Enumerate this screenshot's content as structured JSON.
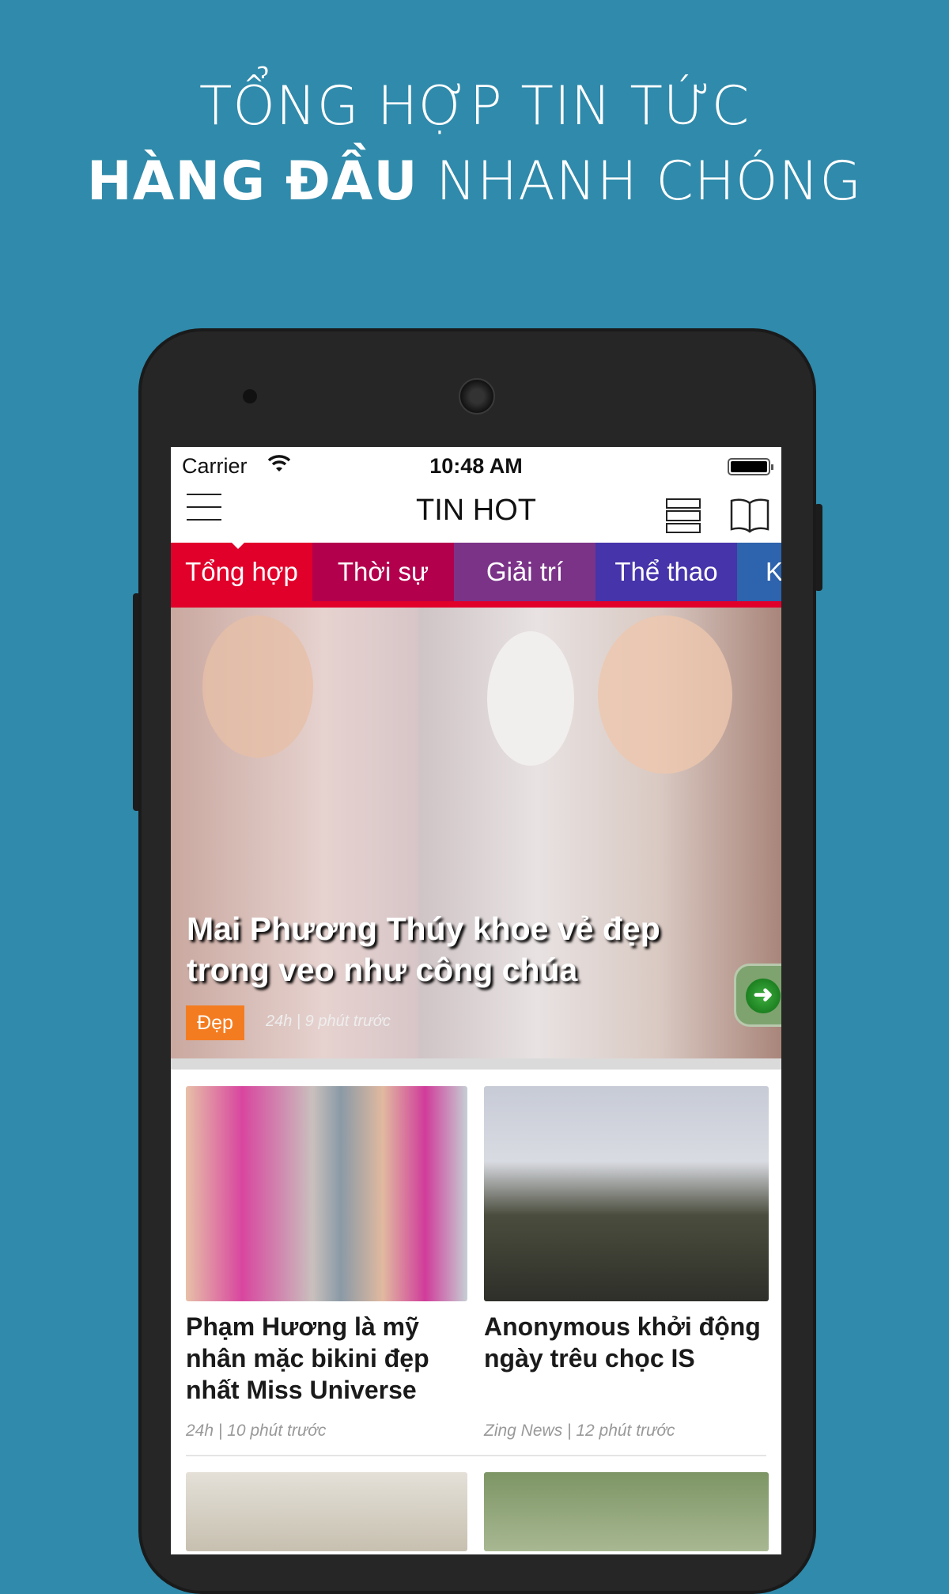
{
  "promo": {
    "line1": "TỔNG HỢP TIN TỨC",
    "line2_bold": "HÀNG ĐẦU",
    "line2_rest": " NHANH CHÓNG"
  },
  "status_bar": {
    "carrier": "Carrier",
    "time": "10:48 AM"
  },
  "nav": {
    "title": "TIN HOT",
    "icons": [
      "menu-icon",
      "list-view-icon",
      "book-icon"
    ]
  },
  "tabs": [
    {
      "label": "Tổng hợp",
      "color": "#e0002a",
      "active": true
    },
    {
      "label": "Thời sự",
      "color": "#b3004d"
    },
    {
      "label": "Giải trí",
      "color": "#7b3388"
    },
    {
      "label": "Thể thao",
      "color": "#4534aa"
    },
    {
      "label": "K",
      "color": "#2e63ad"
    }
  ],
  "hero": {
    "title": "Mai Phương Thúy khoe vẻ đẹp trong veo như công chúa",
    "tag": "Đẹp",
    "meta": "24h | 9 phút trước"
  },
  "articles": [
    {
      "title": "Phạm Hương là mỹ nhân mặc bikini đẹp nhất Miss Universe",
      "meta": "24h | 10 phút trước"
    },
    {
      "title": "Anonymous khởi động ngày trêu chọc IS",
      "meta": "Zing News | 12 phút trước"
    }
  ]
}
